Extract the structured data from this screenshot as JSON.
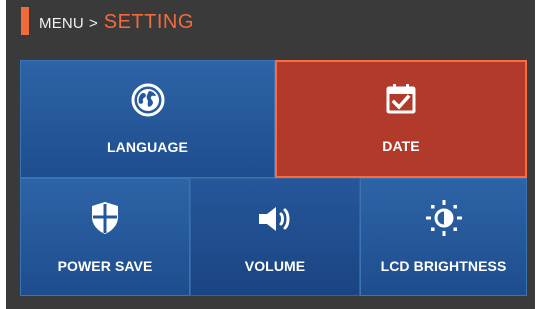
{
  "header": {
    "parent": "MENU",
    "separator": ">",
    "current": "SETTING"
  },
  "menu": {
    "language": {
      "label": "LANGUAGE",
      "icon": "globe-icon"
    },
    "date": {
      "label": "DATE",
      "icon": "calendar-check-icon",
      "selected": true
    },
    "power_save": {
      "label": "POWER SAVE",
      "icon": "shield-icon"
    },
    "volume": {
      "label": "VOLUME",
      "icon": "speaker-icon"
    },
    "lcd_brightness": {
      "label": "LCD BRIGHTNESS",
      "icon": "brightness-icon"
    }
  },
  "colors": {
    "accent": "#f06a3a",
    "selected_tile": "#b23a2a",
    "tile_blue": "#2d64a6",
    "background": "#3a3a3a"
  }
}
